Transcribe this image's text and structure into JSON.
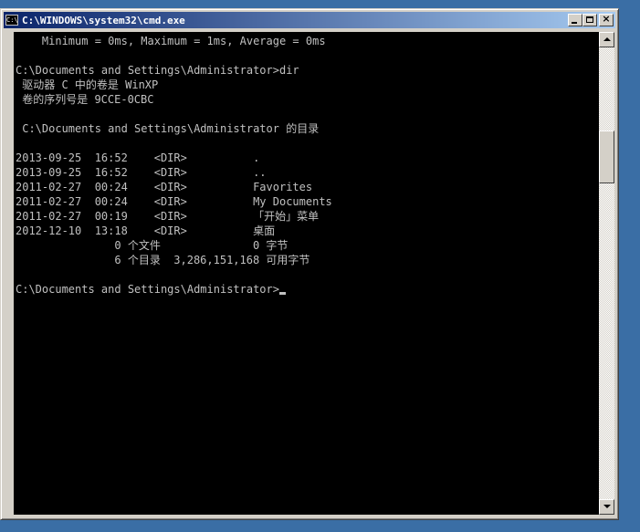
{
  "window": {
    "title": "C:\\WINDOWS\\system32\\cmd.exe",
    "icon": "cmd-icon",
    "icon_glyph": "C:\\",
    "controls": {
      "minimize": "minimize-icon",
      "maximize": "maximize-icon",
      "close": "×"
    }
  },
  "console": {
    "lines": [
      "    Minimum = 0ms, Maximum = 1ms, Average = 0ms",
      "",
      "C:\\Documents and Settings\\Administrator>dir",
      " 驱动器 C 中的卷是 WinXP",
      " 卷的序列号是 9CCE-0CBC",
      "",
      " C:\\Documents and Settings\\Administrator 的目录",
      "",
      "2013-09-25  16:52    <DIR>          .",
      "2013-09-25  16:52    <DIR>          ..",
      "2011-02-27  00:24    <DIR>          Favorites",
      "2011-02-27  00:24    <DIR>          My Documents",
      "2011-02-27  00:19    <DIR>          「开始」菜单",
      "2012-12-10  13:18    <DIR>          桌面",
      "               0 个文件              0 字节",
      "               6 个目录  3,286,151,168 可用字节",
      "",
      "C:\\Documents and Settings\\Administrator>"
    ],
    "colors": {
      "background": "#000000",
      "text": "#c0c0c0"
    }
  },
  "scrollbar": {
    "position_fraction": 0.2
  },
  "colors": {
    "desktop": "#3a6ea5",
    "title_start": "#0a246a",
    "title_end": "#a6caf0",
    "chrome": "#d4d0c8"
  }
}
